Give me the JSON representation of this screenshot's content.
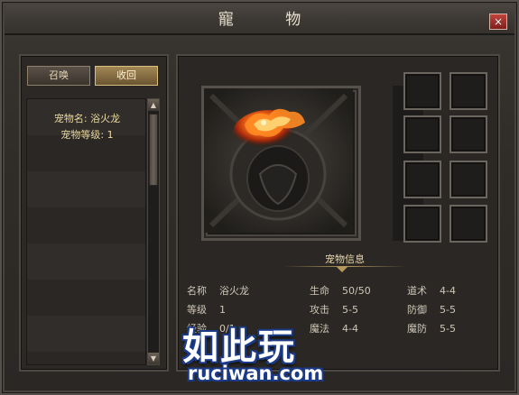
{
  "window": {
    "title": "寵 物",
    "close_label": "×"
  },
  "left": {
    "tabs": [
      {
        "label": "召唤",
        "active": false
      },
      {
        "label": "收回",
        "active": true
      }
    ],
    "pet_name_label": "宠物名: 浴火龙",
    "pet_level_label": "宠物等级: 1"
  },
  "right": {
    "info_title": "宠物信息",
    "stats": {
      "col1": [
        {
          "key": "名称",
          "value": "浴火龙"
        },
        {
          "key": "等级",
          "value": "1"
        },
        {
          "key": "经验",
          "value": "0/1"
        }
      ],
      "col2": [
        {
          "key": "生命",
          "value": "50/50"
        },
        {
          "key": "攻击",
          "value": "5-5"
        },
        {
          "key": "魔法",
          "value": "4-4"
        }
      ],
      "col3": [
        {
          "key": "道术",
          "value": "4-4"
        },
        {
          "key": "防御",
          "value": "5-5"
        },
        {
          "key": "魔防",
          "value": "5-5"
        }
      ]
    }
  },
  "watermark": {
    "cn": "如此玩",
    "en": "ruciwan.com"
  },
  "colors": {
    "accent_gold": "#b7995b",
    "close_red": "#c0433b",
    "watermark_blue": "#1b3a87"
  }
}
